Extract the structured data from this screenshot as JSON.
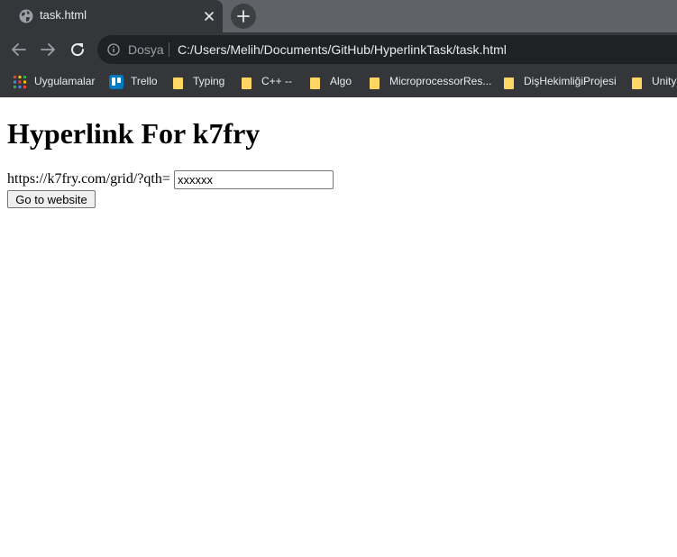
{
  "tab": {
    "title": "task.html",
    "favicon": "globe-icon"
  },
  "toolbar": {
    "scheme_label": "Dosya",
    "url": "C:/Users/Melih/Documents/GitHub/HyperlinkTask/task.html"
  },
  "bookmarks": [
    {
      "label": "Uygulamalar",
      "icon": "apps-grid-icon"
    },
    {
      "label": "Trello",
      "icon": "trello-icon"
    },
    {
      "label": "Typing",
      "icon": "folder-icon"
    },
    {
      "label": "C++ --",
      "icon": "folder-icon"
    },
    {
      "label": "Algo",
      "icon": "folder-icon"
    },
    {
      "label": "MicroprocessorRes...",
      "icon": "folder-icon"
    },
    {
      "label": "DişHekimliğiProjesi",
      "icon": "folder-icon"
    },
    {
      "label": "Unity",
      "icon": "folder-icon"
    }
  ],
  "page": {
    "heading": "Hyperlink For k7fry",
    "url_prefix": "https://k7fry.com/grid/?qth=",
    "input_value": "xxxxxx",
    "button_label": "Go to website"
  },
  "colors": {
    "tabstrip_bg": "#5f6368",
    "toolbar_bg": "#35363a",
    "omnibox_bg": "#202124",
    "folder_yellow": "#fdd663",
    "page_bg": "#ffffff"
  }
}
